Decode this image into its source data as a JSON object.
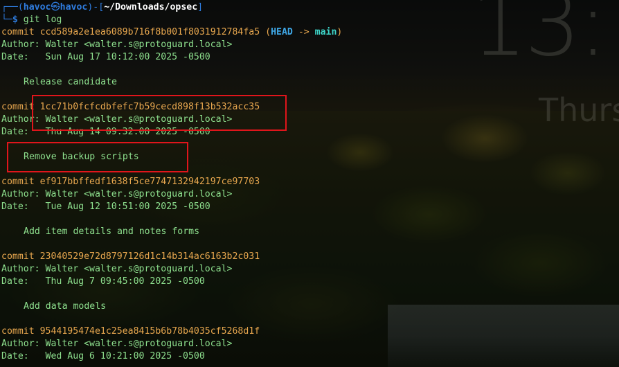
{
  "wallpaper": {
    "clock": "13:",
    "day": "Thurs"
  },
  "prompt": {
    "frame_top": "┌──(",
    "user": "havoc",
    "skull": "㉿",
    "host": "havoc",
    "sep": ")-[",
    "path": "~/Downloads/opsec",
    "close": "]",
    "frame_bottom": "└─",
    "dollar": "$",
    "command": "git log"
  },
  "labels": {
    "commit": "commit",
    "author": "Author:",
    "date": "Date:  "
  },
  "head_ref": {
    "open": "(",
    "head": "HEAD",
    "arrow": "->",
    "branch": "main",
    "close": ")"
  },
  "commits": [
    {
      "hash": "ccd589a2e1ea6089b716f8b001f8031912784fa5",
      "author": "Walter <walter.s@protoguard.local>",
      "date": "Sun Aug 17 10:12:00 2025 -0500",
      "message": "Release candidate"
    },
    {
      "hash": "1cc71b0fcfcdbfefc7b59cecd898f13b532acc35",
      "author": "Walter <walter.s@protoguard.local>",
      "date": "Thu Aug 14 09:32:00 2025 -0500",
      "message": "Remove backup scripts"
    },
    {
      "hash": "ef917bbffedf1638f5ce7747132942197ce97703",
      "author": "Walter <walter.s@protoguard.local>",
      "date": "Tue Aug 12 10:51:00 2025 -0500",
      "message": "Add item details and notes forms"
    },
    {
      "hash": "23040529e72d8797126d1c14b314ac6163b2c031",
      "author": "Walter <walter.s@protoguard.local>",
      "date": "Thu Aug 7 09:45:00 2025 -0500",
      "message": "Add data models"
    },
    {
      "hash": "9544195474e1c25ea8415b6b78b4035cf5268d1f",
      "author": "Walter <walter.s@protoguard.local>",
      "date": "Wed Aug 6 10:21:00 2025 -0500"
    }
  ],
  "colors": {
    "text_green": "#8ee08e",
    "hash_orange": "#e9a84f",
    "prompt_blue": "#2f7de0",
    "branch_cyan": "#3dd4c8",
    "highlight_red": "#e0151b"
  }
}
